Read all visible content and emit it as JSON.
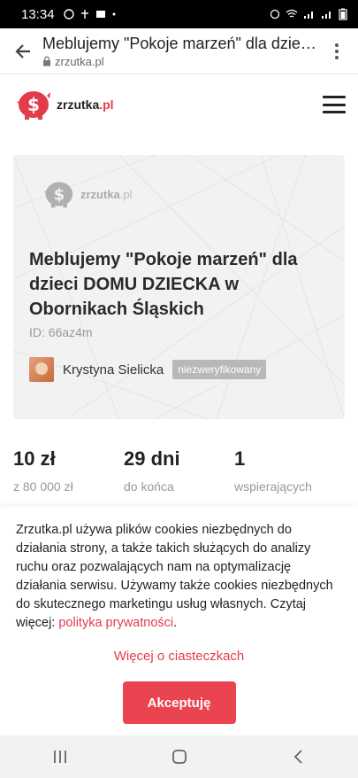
{
  "status_bar": {
    "time": "13:34"
  },
  "browser": {
    "title": "Meblujemy \"Pokoje marzeń\" dla dzie…",
    "url": "zrzutka.pl"
  },
  "site": {
    "logo_main": "zrzutka",
    "logo_tld": ".pl"
  },
  "hero": {
    "logo_main": "zrzutka",
    "logo_tld": ".pl",
    "title": "Meblujemy \"Pokoje marzeń\" dla dzieci DOMU DZIECKA w Obornikach Śląskich",
    "id_text": "ID: 66az4m",
    "author_name": "Krystyna Sielicka",
    "badge": "niezweryfikowany"
  },
  "stats": [
    {
      "value": "10 zł",
      "label": "z 80 000 zł"
    },
    {
      "value": "29 dni",
      "label": "do końca"
    },
    {
      "value": "1",
      "label": "wspierających"
    }
  ],
  "cookie": {
    "text": "Zrzutka.pl używa plików cookies niezbędnych do działania strony, a także takich służących do analizy ruchu oraz pozwalających nam na optymalizację działania serwisu. Używamy także cookies niezbędnych do skutecznego marketingu usług własnych. Czytaj więcej: ",
    "policy_link": "polityka prywatności",
    "period": ".",
    "more_link": "Więcej o ciasteczkach",
    "accept_label": "Akceptuję"
  },
  "colors": {
    "brand": "#e23c4c",
    "accept": "#ea4450"
  }
}
